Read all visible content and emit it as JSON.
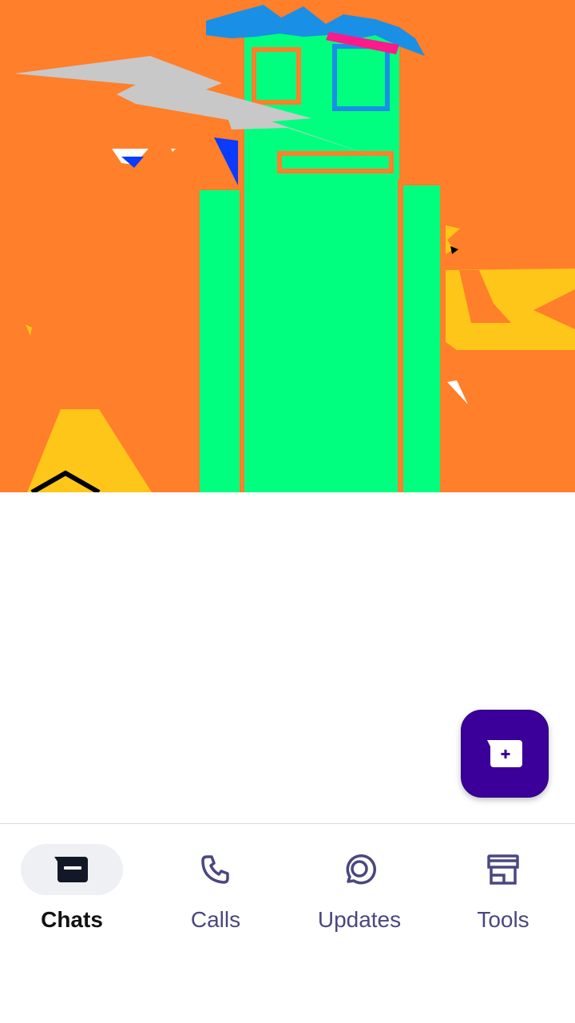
{
  "colors": {
    "accent": "#3a0099",
    "nav_active_bg": "#eef0f4",
    "nav_active_text": "#121212",
    "nav_inactive": "#4a4780",
    "hero_background": "#ff7f2a",
    "hero_figure": "#00ff7f"
  },
  "hero": {
    "image_type": "abstract-illustration"
  },
  "fab": {
    "icon": "new-chat-icon"
  },
  "nav": {
    "items": [
      {
        "label": "Chats",
        "icon": "chat-archive-icon",
        "active": true
      },
      {
        "label": "Calls",
        "icon": "phone-icon",
        "active": false
      },
      {
        "label": "Updates",
        "icon": "status-icon",
        "active": false
      },
      {
        "label": "Tools",
        "icon": "store-icon",
        "active": false
      }
    ]
  }
}
